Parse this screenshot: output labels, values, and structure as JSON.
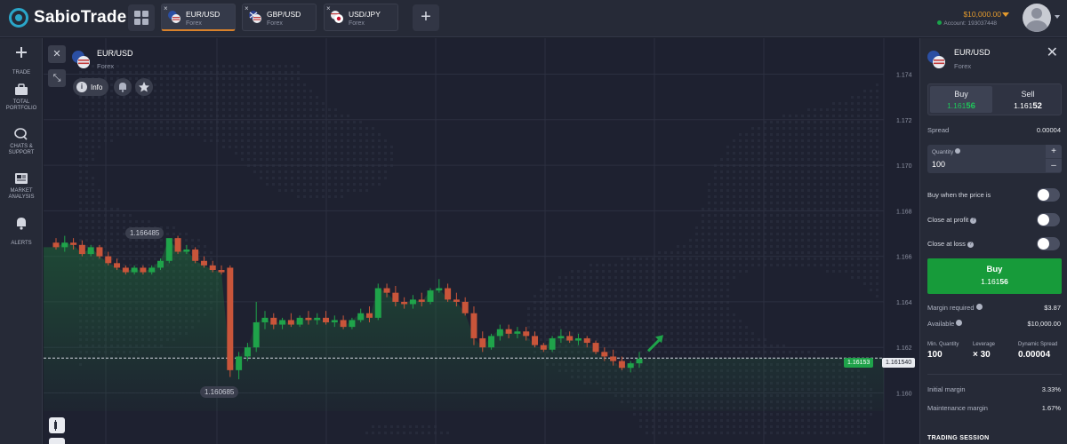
{
  "app": {
    "brand": "SabioTrade"
  },
  "tabs": [
    {
      "pair": "EUR/USD",
      "category": "Forex",
      "active": true
    },
    {
      "pair": "GBP/USD",
      "category": "Forex",
      "active": false
    },
    {
      "pair": "USD/JPY",
      "category": "Forex",
      "active": false
    }
  ],
  "tab_close_glyph": "×",
  "header": {
    "balance": "$10,000.00",
    "account_label": "Account: 193037448"
  },
  "sidebar": {
    "items": [
      {
        "label": "TRADE",
        "icon": "plus-icon"
      },
      {
        "label": "TOTAL PORTFOLIO",
        "icon": "briefcase-icon"
      },
      {
        "label": "CHATS & SUPPORT",
        "icon": "chat-icon"
      },
      {
        "label": "MARKET ANALYSIS",
        "icon": "newspaper-icon"
      },
      {
        "label": "ALERTS",
        "icon": "bell-icon"
      }
    ]
  },
  "chart": {
    "symbol": "EUR/USD",
    "category": "Forex",
    "info_label": "Info",
    "high_label": "1.166485",
    "low_label": "1.160685",
    "bid_tag": "1.16153",
    "ask_tag": "1.161540",
    "colors": {
      "up": "#1fa34a",
      "down": "#c9553a",
      "area": "#1f6b3a"
    }
  },
  "chart_data": {
    "type": "candlestick",
    "yticks": [
      "1.174",
      "1.172",
      "1.170",
      "1.168",
      "1.166",
      "1.164",
      "1.162",
      "1.160"
    ],
    "ylim": [
      1.1592,
      1.1748
    ],
    "current_price": 1.16153,
    "candles": [
      [
        1.1666,
        1.1668,
        1.1663,
        1.1664
      ],
      [
        1.1664,
        1.1669,
        1.1662,
        1.1666
      ],
      [
        1.1666,
        1.1668,
        1.1663,
        1.1665
      ],
      [
        1.1665,
        1.1667,
        1.166,
        1.1661
      ],
      [
        1.1661,
        1.1665,
        1.166,
        1.1664
      ],
      [
        1.1664,
        1.1665,
        1.1659,
        1.166
      ],
      [
        1.166,
        1.1662,
        1.1656,
        1.1657
      ],
      [
        1.1657,
        1.1659,
        1.1654,
        1.1655
      ],
      [
        1.1655,
        1.1656,
        1.1652,
        1.1653
      ],
      [
        1.1653,
        1.1656,
        1.1652,
        1.1655
      ],
      [
        1.1655,
        1.1656,
        1.1652,
        1.1653
      ],
      [
        1.1653,
        1.1656,
        1.1652,
        1.1655
      ],
      [
        1.1655,
        1.1659,
        1.1654,
        1.1658
      ],
      [
        1.1658,
        1.1665,
        1.1657,
        1.1668
      ],
      [
        1.1668,
        1.1669,
        1.1661,
        1.1662
      ],
      [
        1.1662,
        1.1665,
        1.1661,
        1.1663
      ],
      [
        1.1663,
        1.1664,
        1.1657,
        1.1658
      ],
      [
        1.1658,
        1.166,
        1.1655,
        1.1656
      ],
      [
        1.1656,
        1.1658,
        1.1653,
        1.1654
      ],
      [
        1.1654,
        1.1656,
        1.1652,
        1.1653
      ],
      [
        1.1655,
        1.1656,
        1.1607,
        1.161
      ],
      [
        1.161,
        1.1618,
        1.1606,
        1.1616
      ],
      [
        1.1616,
        1.1622,
        1.1614,
        1.162
      ],
      [
        1.162,
        1.164,
        1.1618,
        1.1631
      ],
      [
        1.1631,
        1.1636,
        1.1628,
        1.1633
      ],
      [
        1.1633,
        1.1635,
        1.1628,
        1.163
      ],
      [
        1.163,
        1.1633,
        1.1628,
        1.1632
      ],
      [
        1.1632,
        1.1635,
        1.1629,
        1.163
      ],
      [
        1.163,
        1.1634,
        1.1629,
        1.1633
      ],
      [
        1.1633,
        1.1636,
        1.163,
        1.1632
      ],
      [
        1.1632,
        1.1635,
        1.163,
        1.1633
      ],
      [
        1.1633,
        1.1636,
        1.163,
        1.1631
      ],
      [
        1.1631,
        1.1634,
        1.1629,
        1.1632
      ],
      [
        1.1632,
        1.1634,
        1.1628,
        1.1629
      ],
      [
        1.1629,
        1.1633,
        1.1628,
        1.1632
      ],
      [
        1.1632,
        1.1637,
        1.1631,
        1.1635
      ],
      [
        1.1635,
        1.1638,
        1.1631,
        1.1633
      ],
      [
        1.1633,
        1.1648,
        1.1632,
        1.1646
      ],
      [
        1.1646,
        1.1648,
        1.1642,
        1.1644
      ],
      [
        1.1644,
        1.1647,
        1.1638,
        1.164
      ],
      [
        1.164,
        1.1642,
        1.1637,
        1.1639
      ],
      [
        1.1639,
        1.1643,
        1.1637,
        1.1641
      ],
      [
        1.1641,
        1.1644,
        1.1638,
        1.164
      ],
      [
        1.164,
        1.1646,
        1.1639,
        1.1645
      ],
      [
        1.1645,
        1.165,
        1.1644,
        1.1646
      ],
      [
        1.1646,
        1.1648,
        1.164,
        1.1641
      ],
      [
        1.1641,
        1.1644,
        1.1638,
        1.164
      ],
      [
        1.164,
        1.1642,
        1.1634,
        1.1635
      ],
      [
        1.1635,
        1.1638,
        1.1621,
        1.1624
      ],
      [
        1.1624,
        1.1627,
        1.1618,
        1.162
      ],
      [
        1.162,
        1.1626,
        1.1619,
        1.1625
      ],
      [
        1.1625,
        1.163,
        1.1623,
        1.1628
      ],
      [
        1.1628,
        1.163,
        1.1624,
        1.1626
      ],
      [
        1.1626,
        1.1629,
        1.1624,
        1.1627
      ],
      [
        1.1627,
        1.1629,
        1.1623,
        1.1625
      ],
      [
        1.1625,
        1.1627,
        1.162,
        1.1621
      ],
      [
        1.1621,
        1.1622,
        1.1618,
        1.1619
      ],
      [
        1.1619,
        1.1625,
        1.1618,
        1.1624
      ],
      [
        1.1624,
        1.1628,
        1.1622,
        1.1625
      ],
      [
        1.1625,
        1.1627,
        1.1622,
        1.1623
      ],
      [
        1.1623,
        1.1626,
        1.1621,
        1.1624
      ],
      [
        1.1624,
        1.1625,
        1.162,
        1.1622
      ],
      [
        1.1622,
        1.1623,
        1.1617,
        1.1618
      ],
      [
        1.1618,
        1.162,
        1.1614,
        1.1616
      ],
      [
        1.1616,
        1.1619,
        1.1612,
        1.1614
      ],
      [
        1.1614,
        1.1616,
        1.161,
        1.1611
      ],
      [
        1.1611,
        1.1614,
        1.1609,
        1.1613
      ],
      [
        1.1613,
        1.1618,
        1.1611,
        1.1615
      ]
    ]
  },
  "panel": {
    "symbol": "EUR/USD",
    "category": "Forex",
    "buy_label": "Buy",
    "buy_price_main": "1.161",
    "buy_price_big": "56",
    "sell_label": "Sell",
    "sell_price_main": "1.161",
    "sell_price_big": "52",
    "spread_label": "Spread",
    "spread_value": "0.00004",
    "quantity_label": "Quantity",
    "quantity_value": "100",
    "toggles": [
      "Buy when the price is",
      "Close at profit",
      "Close at loss"
    ],
    "buy_button_label": "Buy",
    "buy_button_price_main": "1.161",
    "buy_button_price_big": "56",
    "margin_required_label": "Margin required",
    "margin_required_value": "$3.87",
    "available_label": "Available",
    "available_value": "$10,000.00",
    "stats": [
      {
        "label": "Min. Quantity",
        "value": "100"
      },
      {
        "label": "Leverage",
        "value": "× 30"
      },
      {
        "label": "Dynamic Spread",
        "value": "0.00004"
      }
    ],
    "initial_margin_label": "Initial margin",
    "initial_margin_value": "3.33%",
    "maintenance_margin_label": "Maintenance margin",
    "maintenance_margin_value": "1.67%",
    "trading_session_label": "TRADING SESSION"
  }
}
